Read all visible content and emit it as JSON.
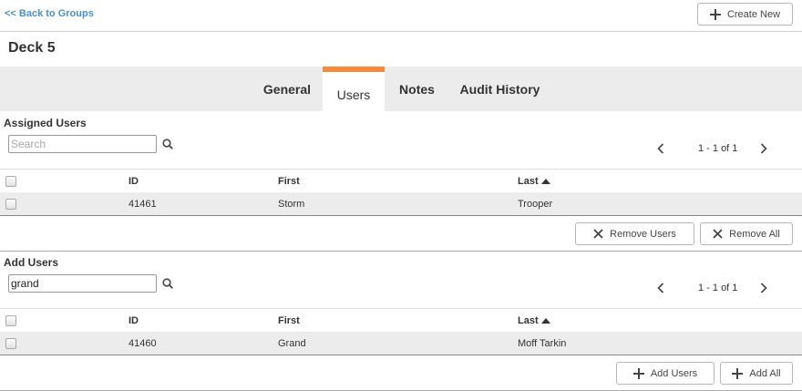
{
  "nav": {
    "back_label": "<< Back to Groups"
  },
  "toolbar": {
    "create_label": "Create New"
  },
  "page": {
    "title": "Deck 5"
  },
  "tabs": [
    {
      "label": "General",
      "active": false
    },
    {
      "label": "Users",
      "active": true
    },
    {
      "label": "Notes",
      "active": false
    },
    {
      "label": "Audit History",
      "active": false
    }
  ],
  "colors": {
    "accent_tab": "#f68b3c",
    "link": "#4a90c8",
    "tab_bar_bg": "#ececec"
  },
  "assigned_users": {
    "title": "Assigned Users",
    "search": {
      "value": "",
      "placeholder": "Search"
    },
    "pager": "1 - 1 of 1",
    "columns": [
      "ID",
      "First",
      "Last"
    ],
    "sorted_column": "Last",
    "rows": [
      {
        "id": "41461",
        "first": "Storm",
        "last": "Trooper"
      }
    ],
    "remove_users_label": "Remove Users",
    "remove_all_label": "Remove All"
  },
  "add_users": {
    "title": "Add Users",
    "search": {
      "value": "grand",
      "placeholder": ""
    },
    "pager": "1 - 1 of 1",
    "columns": [
      "ID",
      "First",
      "Last"
    ],
    "sorted_column": "Last",
    "rows": [
      {
        "id": "41460",
        "first": "Grand",
        "last": "Moff Tarkin"
      }
    ],
    "add_users_label": "Add Users",
    "add_all_label": "Add All"
  }
}
